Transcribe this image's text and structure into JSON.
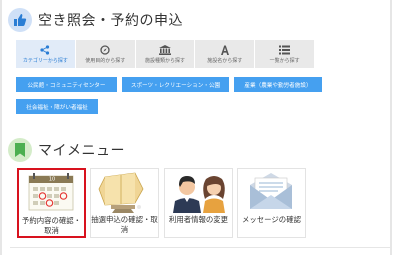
{
  "reserve": {
    "title": "空き照会・予約の申込",
    "tabs": [
      {
        "label": "カテゴリーから探す",
        "icon": "share-icon"
      },
      {
        "label": "使用目的から探す",
        "icon": "compass-icon"
      },
      {
        "label": "施設種類から探す",
        "icon": "building-icon"
      },
      {
        "label": "施設名から探す",
        "icon": "letter-a-icon"
      },
      {
        "label": "一覧から探す",
        "icon": "list-icon"
      }
    ],
    "categories": [
      "公民館・コミュニティセンター",
      "スポーツ・レクリエーション・公園",
      "産業（農業や勤労者施設）",
      "社会福祉・障がい者福祉"
    ]
  },
  "mymenu": {
    "title": "マイメニュー",
    "cards": [
      {
        "label": "予約内容の確認・取消",
        "icon": "calendar-icon"
      },
      {
        "label": "抽選申込の確認・取消",
        "icon": "lottery-drum-icon"
      },
      {
        "label": "利用者情報の変更",
        "icon": "users-icon"
      },
      {
        "label": "メッセージの確認",
        "icon": "mail-icon"
      }
    ]
  },
  "colors": {
    "accent_blue": "#45a0f0",
    "active_tab_text": "#2a7dd4",
    "selected_border": "#d8121e",
    "thumb_icon": "#2a7dd4",
    "book_icon": "#4caf50"
  }
}
